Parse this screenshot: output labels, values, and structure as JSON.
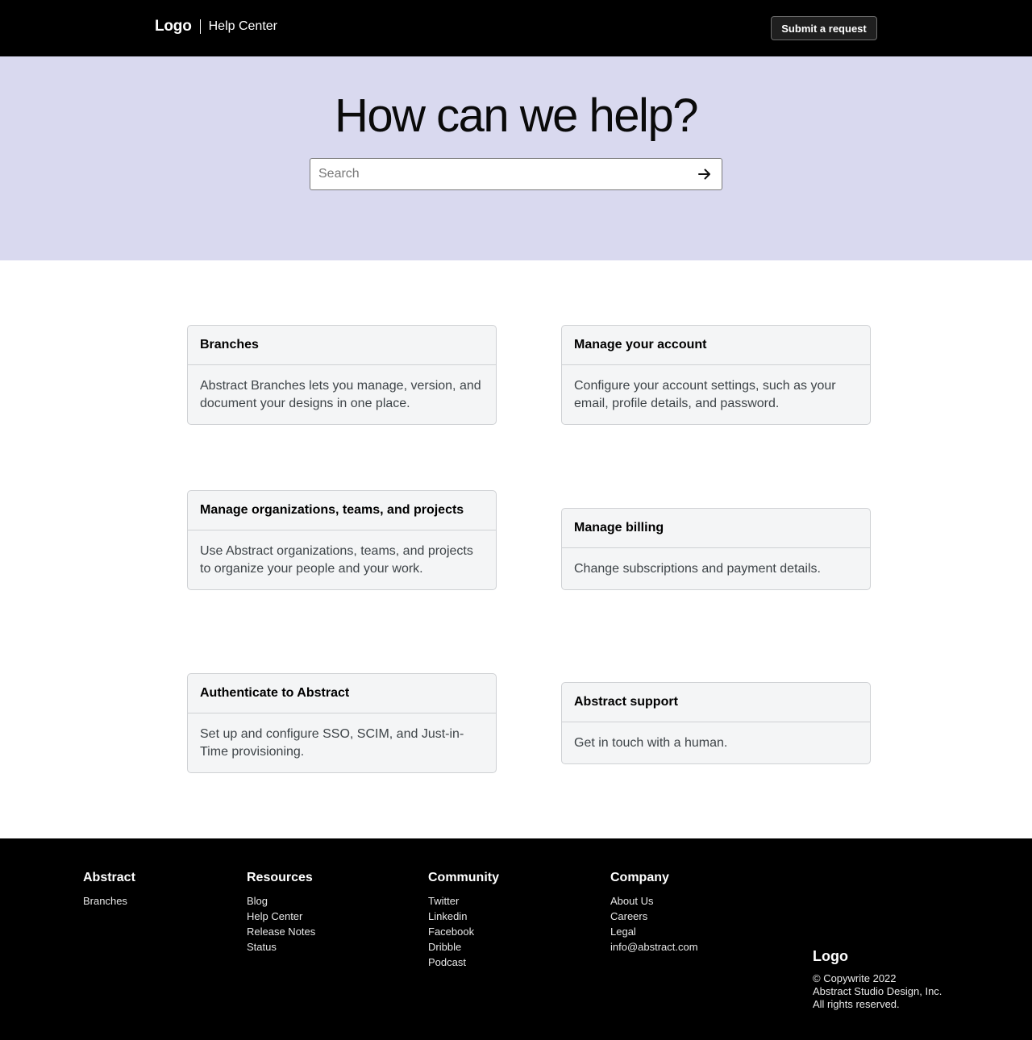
{
  "header": {
    "logo": "Logo",
    "section": "Help Center",
    "submit_label": "Submit a request"
  },
  "hero": {
    "title": "How can we help?",
    "search_placeholder": "Search"
  },
  "cards": [
    {
      "title": "Branches",
      "description": "Abstract Branches lets you manage, version, and document your designs in one place."
    },
    {
      "title": "Manage your account",
      "description": "Configure your account settings, such as your email, profile details, and password."
    },
    {
      "title": "Manage organizations, teams, and projects",
      "description": "Use Abstract organizations, teams, and projects to organize your people and your work."
    },
    {
      "title": "Manage billing",
      "description": "Change subscriptions and payment details."
    },
    {
      "title": "Authenticate to Abstract",
      "description": "Set up and configure SSO, SCIM, and Just-in-Time provisioning."
    },
    {
      "title": "Abstract support",
      "description": "Get in touch with a human."
    }
  ],
  "footer": {
    "columns": [
      {
        "heading": "Abstract",
        "links": [
          "Branches"
        ]
      },
      {
        "heading": "Resources",
        "links": [
          "Blog",
          "Help Center",
          "Release Notes",
          "Status"
        ]
      },
      {
        "heading": "Community",
        "links": [
          "Twitter",
          "Linkedin",
          "Facebook",
          "Dribble",
          "Podcast"
        ]
      },
      {
        "heading": "Company",
        "links": [
          "About Us",
          "Careers",
          "Legal",
          "info@abstract.com"
        ]
      }
    ],
    "logo": "Logo",
    "copyright": [
      "© Copywrite 2022",
      "Abstract Studio Design, Inc.",
      "All rights reserved."
    ]
  },
  "colors": {
    "header_bg": "#000000",
    "hero_bg": "#d9d9ef",
    "card_bg": "#f4f5f6",
    "card_border": "#cfd1d4",
    "footer_bg": "#000000"
  },
  "icons": {
    "search_submit": "arrow-right-icon"
  }
}
